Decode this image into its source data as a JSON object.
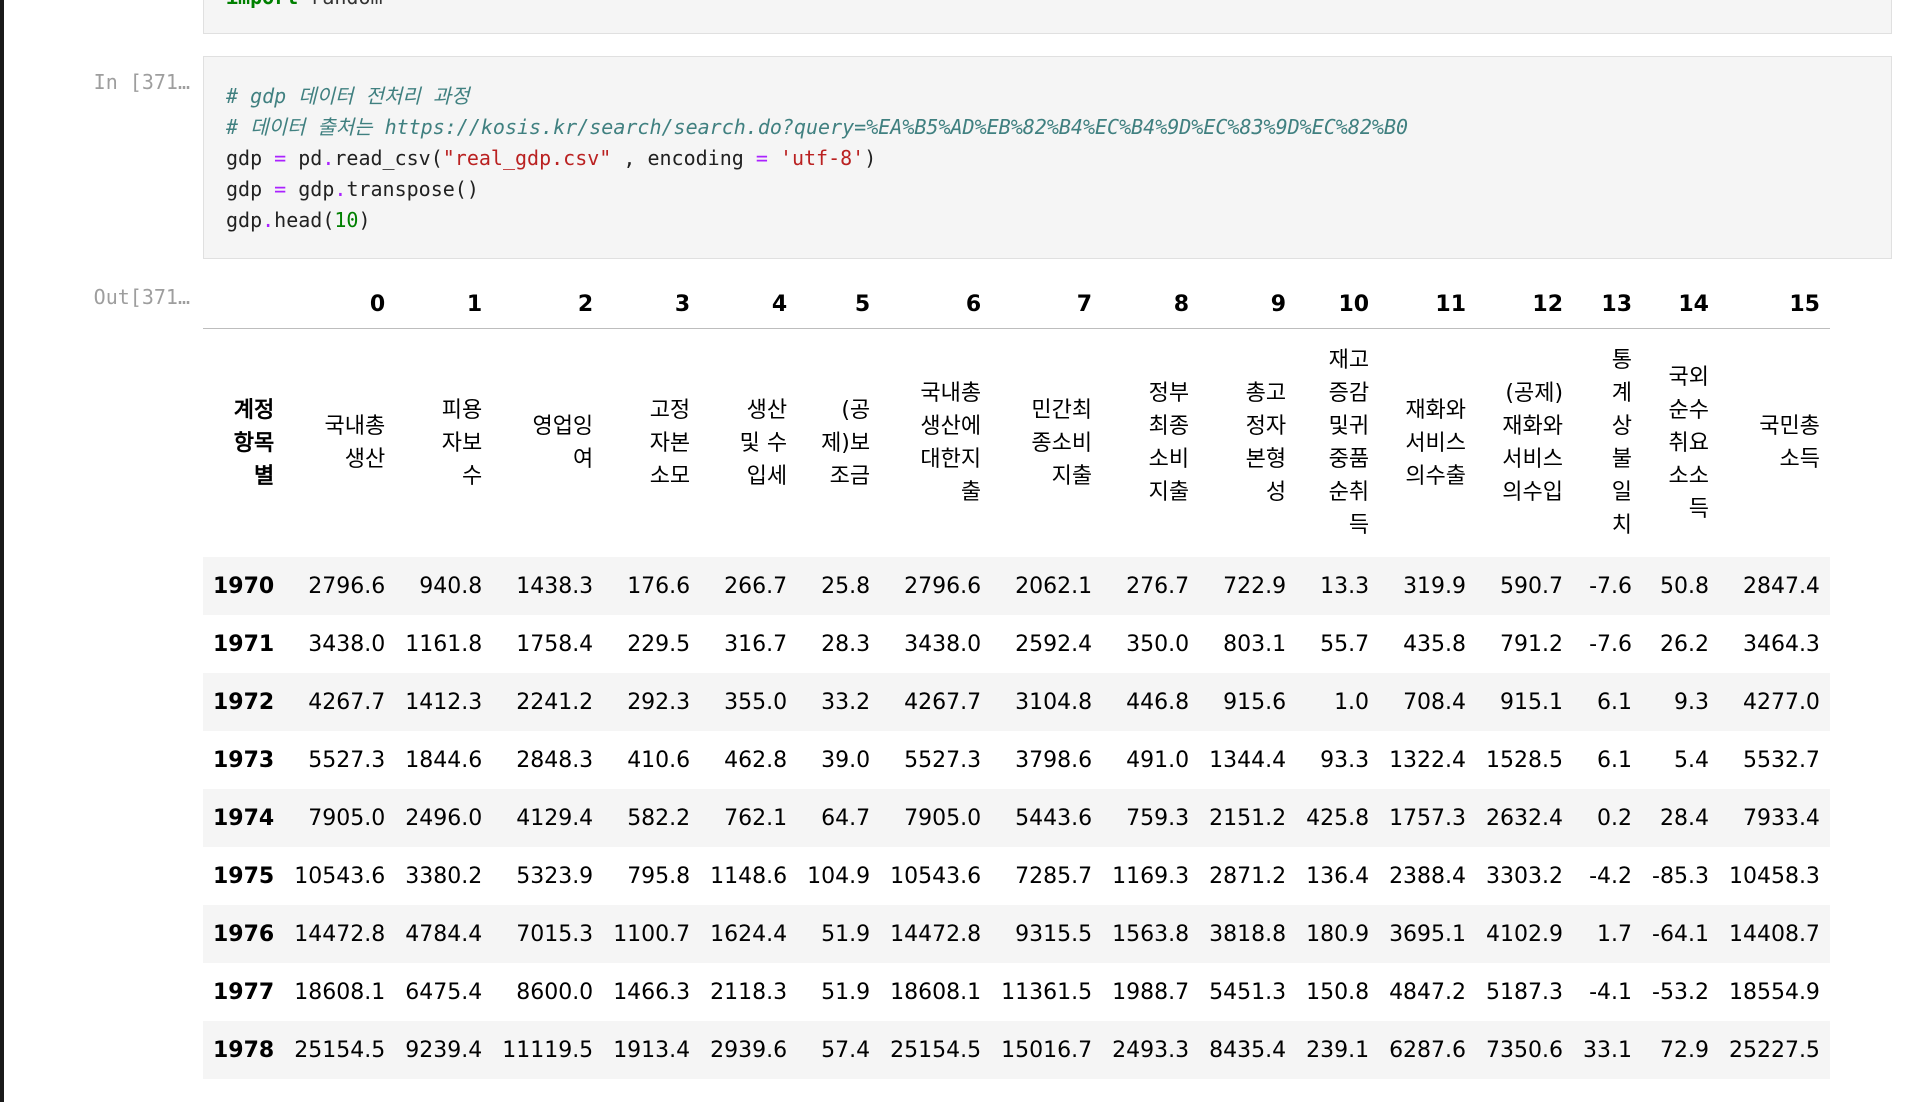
{
  "prev_cell": {
    "code": "import random"
  },
  "cell": {
    "in_prompt": "In [371…",
    "code_lines": [
      {
        "parts": [
          {
            "t": "# gdp 데이터 전처리 과정",
            "c": "c-comment"
          }
        ]
      },
      {
        "parts": [
          {
            "t": "# 데이터 출처는 https://kosis.kr/search/search.do?query=%EA%B5%AD%EB%82%B4%EC%B4%9D%EC%83%9D%EC%82%B0",
            "c": "c-comment"
          }
        ]
      },
      {
        "parts": [
          {
            "t": "gdp ",
            "c": ""
          },
          {
            "t": "=",
            "c": "c-op"
          },
          {
            "t": " pd",
            "c": ""
          },
          {
            "t": ".",
            "c": "c-op"
          },
          {
            "t": "read_csv(",
            "c": ""
          },
          {
            "t": "\"real_gdp.csv\"",
            "c": "c-str"
          },
          {
            "t": " , encoding ",
            "c": ""
          },
          {
            "t": "=",
            "c": "c-op"
          },
          {
            "t": " ",
            "c": ""
          },
          {
            "t": "'utf-8'",
            "c": "c-str"
          },
          {
            "t": ")",
            "c": ""
          }
        ]
      },
      {
        "parts": [
          {
            "t": "gdp ",
            "c": ""
          },
          {
            "t": "=",
            "c": "c-op"
          },
          {
            "t": " gdp",
            "c": ""
          },
          {
            "t": ".",
            "c": "c-op"
          },
          {
            "t": "transpose()",
            "c": ""
          }
        ]
      },
      {
        "parts": [
          {
            "t": "gdp",
            "c": ""
          },
          {
            "t": ".",
            "c": "c-op"
          },
          {
            "t": "head(",
            "c": ""
          },
          {
            "t": "10",
            "c": "c-num"
          },
          {
            "t": ")",
            "c": ""
          }
        ]
      }
    ]
  },
  "output": {
    "out_prompt": "Out[371…",
    "column_indices": [
      "0",
      "1",
      "2",
      "3",
      "4",
      "5",
      "6",
      "7",
      "8",
      "9",
      "10",
      "11",
      "12",
      "13",
      "14",
      "15"
    ],
    "index_name": "계정항목별",
    "column_names": [
      "국내총생산",
      "피용자보수",
      "영업잉여",
      "고정자본소모",
      "생산 및 수입세",
      "(공제)보조금",
      "국내총생산에 대한지출",
      "민간최종소비지출",
      "정부최종소비지출",
      "총고정자본형성",
      "재고증감 및귀중품 순취득",
      "재화와서비스의수출",
      "(공제)재화와서비스의수입",
      "통계상불일치",
      "국외순수취요소소득",
      "국민총소득"
    ],
    "rows": [
      {
        "year": "1970",
        "values": [
          "2796.6",
          "940.8",
          "1438.3",
          "176.6",
          "266.7",
          "25.8",
          "2796.6",
          "2062.1",
          "276.7",
          "722.9",
          "13.3",
          "319.9",
          "590.7",
          "-7.6",
          "50.8",
          "2847.4"
        ]
      },
      {
        "year": "1971",
        "values": [
          "3438.0",
          "1161.8",
          "1758.4",
          "229.5",
          "316.7",
          "28.3",
          "3438.0",
          "2592.4",
          "350.0",
          "803.1",
          "55.7",
          "435.8",
          "791.2",
          "-7.6",
          "26.2",
          "3464.3"
        ]
      },
      {
        "year": "1972",
        "values": [
          "4267.7",
          "1412.3",
          "2241.2",
          "292.3",
          "355.0",
          "33.2",
          "4267.7",
          "3104.8",
          "446.8",
          "915.6",
          "1.0",
          "708.4",
          "915.1",
          "6.1",
          "9.3",
          "4277.0"
        ]
      },
      {
        "year": "1973",
        "values": [
          "5527.3",
          "1844.6",
          "2848.3",
          "410.6",
          "462.8",
          "39.0",
          "5527.3",
          "3798.6",
          "491.0",
          "1344.4",
          "93.3",
          "1322.4",
          "1528.5",
          "6.1",
          "5.4",
          "5532.7"
        ]
      },
      {
        "year": "1974",
        "values": [
          "7905.0",
          "2496.0",
          "4129.4",
          "582.2",
          "762.1",
          "64.7",
          "7905.0",
          "5443.6",
          "759.3",
          "2151.2",
          "425.8",
          "1757.3",
          "2632.4",
          "0.2",
          "28.4",
          "7933.4"
        ]
      },
      {
        "year": "1975",
        "values": [
          "10543.6",
          "3380.2",
          "5323.9",
          "795.8",
          "1148.6",
          "104.9",
          "10543.6",
          "7285.7",
          "1169.3",
          "2871.2",
          "136.4",
          "2388.4",
          "3303.2",
          "-4.2",
          "-85.3",
          "10458.3"
        ]
      },
      {
        "year": "1976",
        "values": [
          "14472.8",
          "4784.4",
          "7015.3",
          "1100.7",
          "1624.4",
          "51.9",
          "14472.8",
          "9315.5",
          "1563.8",
          "3818.8",
          "180.9",
          "3695.1",
          "4102.9",
          "1.7",
          "-64.1",
          "14408.7"
        ]
      },
      {
        "year": "1977",
        "values": [
          "18608.1",
          "6475.4",
          "8600.0",
          "1466.3",
          "2118.3",
          "51.9",
          "18608.1",
          "11361.5",
          "1988.7",
          "5451.3",
          "150.8",
          "4847.2",
          "5187.3",
          "-4.1",
          "-53.2",
          "18554.9"
        ]
      },
      {
        "year": "1978",
        "values": [
          "25154.5",
          "9239.4",
          "11119.5",
          "1913.4",
          "2939.6",
          "57.4",
          "25154.5",
          "15016.7",
          "2493.3",
          "8435.4",
          "239.1",
          "6287.6",
          "7350.6",
          "33.1",
          "72.9",
          "25227.5"
        ]
      }
    ]
  }
}
